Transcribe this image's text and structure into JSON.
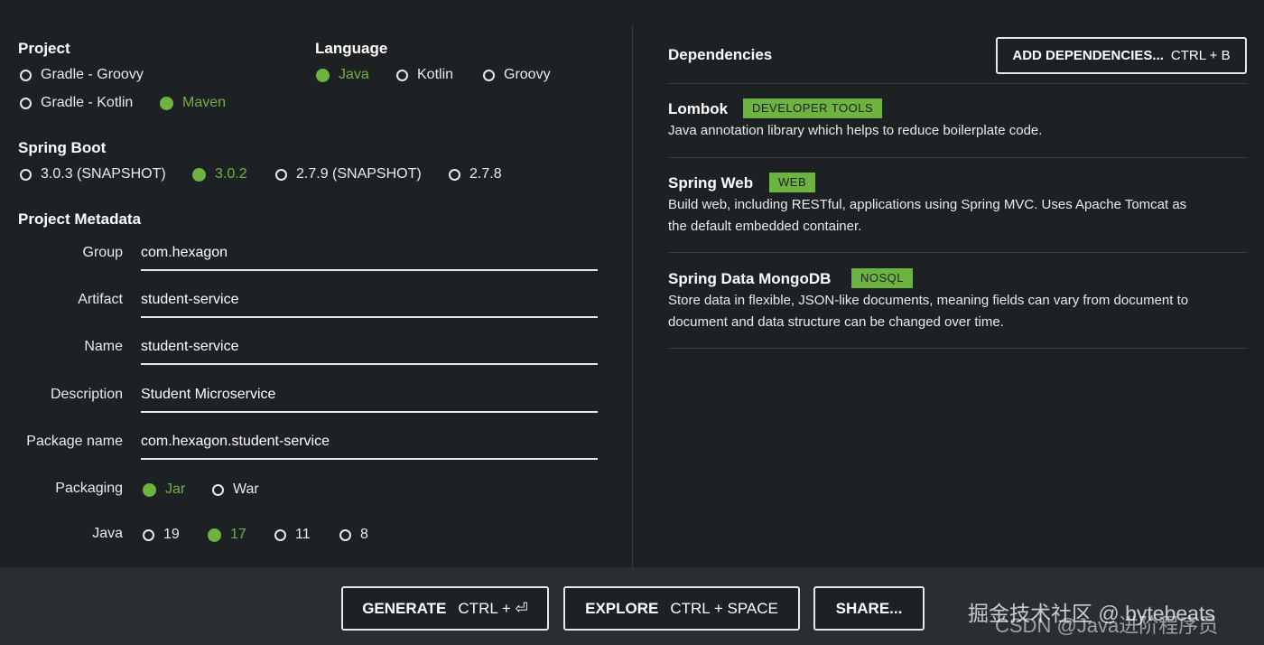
{
  "project": {
    "heading": "Project",
    "options": [
      "Gradle - Groovy",
      "Gradle - Kotlin",
      "Maven"
    ],
    "selected": "Maven"
  },
  "language": {
    "heading": "Language",
    "options": [
      "Java",
      "Kotlin",
      "Groovy"
    ],
    "selected": "Java"
  },
  "spring_boot": {
    "heading": "Spring Boot",
    "options": [
      "3.0.3 (SNAPSHOT)",
      "3.0.2",
      "2.7.9 (SNAPSHOT)",
      "2.7.8"
    ],
    "selected": "3.0.2"
  },
  "metadata": {
    "heading": "Project Metadata",
    "fields": [
      {
        "label": "Group",
        "value": "com.hexagon"
      },
      {
        "label": "Artifact",
        "value": "student-service"
      },
      {
        "label": "Name",
        "value": "student-service"
      },
      {
        "label": "Description",
        "value": "Student Microservice"
      },
      {
        "label": "Package name",
        "value": "com.hexagon.student-service"
      }
    ],
    "packaging": {
      "label": "Packaging",
      "options": [
        "Jar",
        "War"
      ],
      "selected": "Jar"
    },
    "java": {
      "label": "Java",
      "options": [
        "19",
        "17",
        "11",
        "8"
      ],
      "selected": "17"
    }
  },
  "dependencies": {
    "heading": "Dependencies",
    "add_button": {
      "label": "ADD DEPENDENCIES...",
      "shortcut": "CTRL + B"
    },
    "items": [
      {
        "name": "Lombok",
        "badge": "DEVELOPER TOOLS",
        "description": "Java annotation library which helps to reduce boilerplate code."
      },
      {
        "name": "Spring Web",
        "badge": "WEB",
        "description": "Build web, including RESTful, applications using Spring MVC. Uses Apache Tomcat as the default embedded container."
      },
      {
        "name": "Spring Data MongoDB",
        "badge": "NOSQL",
        "description": "Store data in flexible, JSON-like documents, meaning fields can vary from document to document and data structure can be changed over time."
      }
    ]
  },
  "footer": {
    "generate": {
      "label": "GENERATE",
      "shortcut": "CTRL + ⏎"
    },
    "explore": {
      "label": "EXPLORE",
      "shortcut": "CTRL + SPACE"
    },
    "share": {
      "label": "SHARE..."
    }
  },
  "watermark": {
    "line1": "掘金技术社区 @ bytebeats",
    "line2": "CSDN @Java进阶程序员"
  },
  "colors": {
    "accent": "#6db33f",
    "background": "#1e2124",
    "footer": "#2a2e33"
  }
}
